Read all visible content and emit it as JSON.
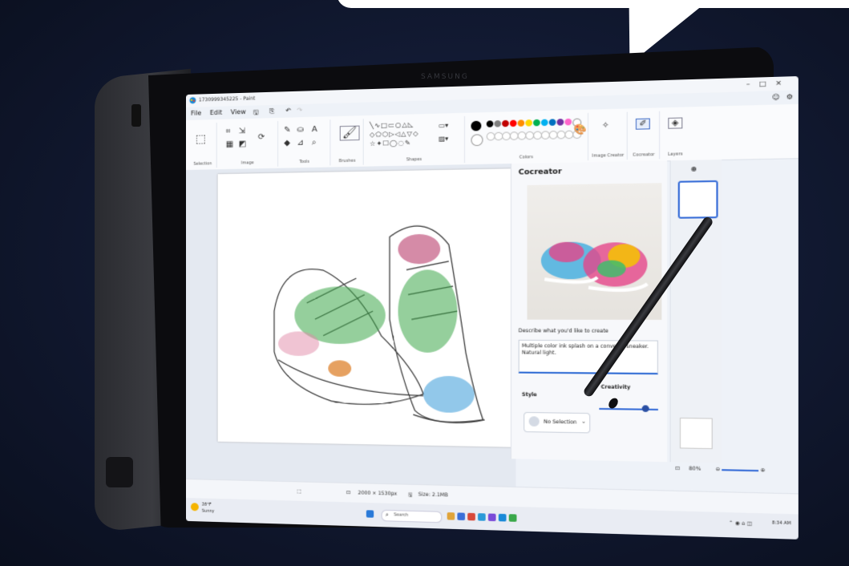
{
  "window": {
    "title": "1730999345225 - Paint",
    "brand": "SAMSUNG"
  },
  "menu": {
    "items": [
      "File",
      "Edit",
      "View"
    ]
  },
  "ribbon": {
    "groups": [
      "Selection",
      "Image",
      "Tools",
      "Brushes",
      "Shapes",
      "Colors",
      "Image Creator",
      "Cocreator",
      "Layers"
    ]
  },
  "colors": {
    "palette": [
      "#000000",
      "#7f7f7f",
      "#c00000",
      "#ff0000",
      "#ff8c00",
      "#ffd700",
      "#00b050",
      "#00b0f0",
      "#0070c0",
      "#7030a0",
      "#ff66cc",
      "#ffffff"
    ]
  },
  "cocreator": {
    "title": "Cocreator",
    "describe_label": "Describe what you'd like to create",
    "prompt_text": "Multiple color ink splash on a converse sneaker. Natural light.",
    "style_label": "Style",
    "style_value": "No Selection",
    "creativity_label": "Creativity",
    "creativity_level": 0.75
  },
  "status": {
    "dimensions": "2000 × 1530px",
    "size": "Size: 2.1MB",
    "zoom": "80%"
  },
  "taskbar": {
    "weather_temp": "28°F",
    "weather_text": "Sunny",
    "search_placeholder": "Search",
    "clock": "8:34 AM"
  }
}
